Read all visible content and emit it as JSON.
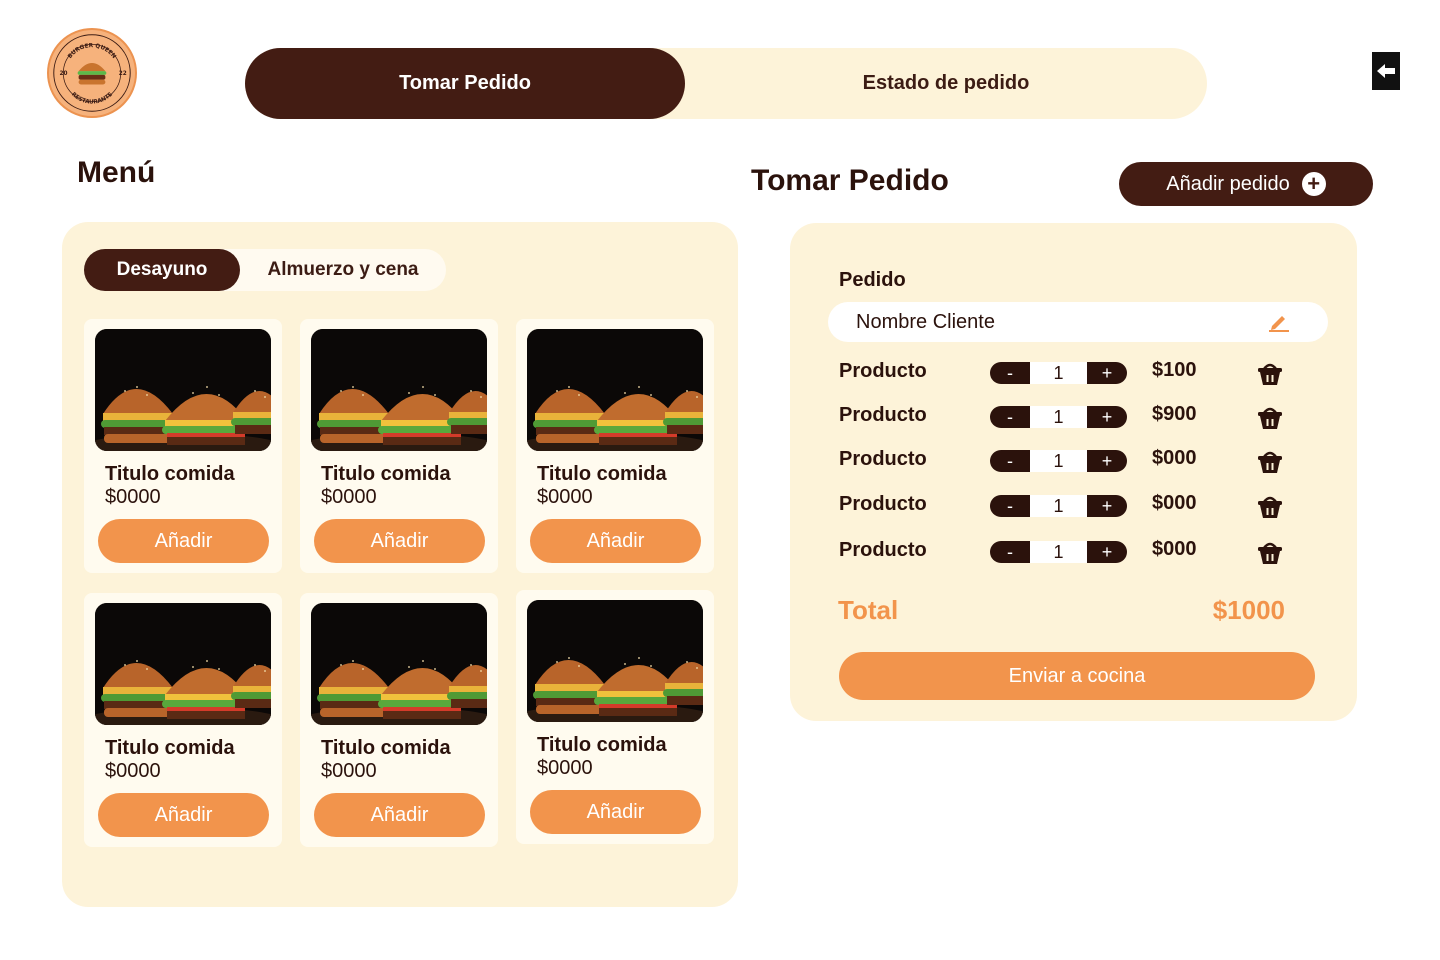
{
  "logo": {
    "name": "BURGER QUEEN",
    "subtitle": "RESTAURANTE",
    "year_left": "20",
    "year_right": "22",
    "icon": "burger-icon"
  },
  "topnav": {
    "tabs": [
      {
        "label": "Tomar Pedido",
        "active": true
      },
      {
        "label": "Estado de pedido",
        "active": false
      }
    ],
    "logout_icon": "logout-icon"
  },
  "menu": {
    "title": "Menú",
    "categories": [
      {
        "label": "Desayuno",
        "active": true
      },
      {
        "label": "Almuerzo y cena",
        "active": false
      }
    ],
    "items": [
      {
        "title": "Titulo comida",
        "price": "$0000",
        "button": "Añadir"
      },
      {
        "title": "Titulo comida",
        "price": "$0000",
        "button": "Añadir"
      },
      {
        "title": "Titulo comida",
        "price": "$0000",
        "button": "Añadir"
      },
      {
        "title": "Titulo comida",
        "price": "$0000",
        "button": "Añadir"
      },
      {
        "title": "Titulo comida",
        "price": "$0000",
        "button": "Añadir"
      },
      {
        "title": "Titulo comida",
        "price": "$0000",
        "button": "Añadir"
      }
    ]
  },
  "order": {
    "title": "Tomar Pedido",
    "add_order_label": "Añadir pedido",
    "section_label": "Pedido",
    "client_placeholder": "Nombre Cliente",
    "lines": [
      {
        "product": "Producto",
        "qty": "1",
        "price": "$100"
      },
      {
        "product": "Producto",
        "qty": "1",
        "price": "$900"
      },
      {
        "product": "Producto",
        "qty": "1",
        "price": "$000"
      },
      {
        "product": "Producto",
        "qty": "1",
        "price": "$000"
      },
      {
        "product": "Producto",
        "qty": "1",
        "price": "$000"
      }
    ],
    "stepper_minus": "-",
    "stepper_plus": "+",
    "total_label": "Total",
    "total_value": "$1000",
    "send_label": "Enviar a cocina"
  },
  "colors": {
    "dark_brown": "#431c13",
    "cream": "#fdf3d9",
    "orange": "#f2944c",
    "logo_peach": "#f6b27c"
  }
}
